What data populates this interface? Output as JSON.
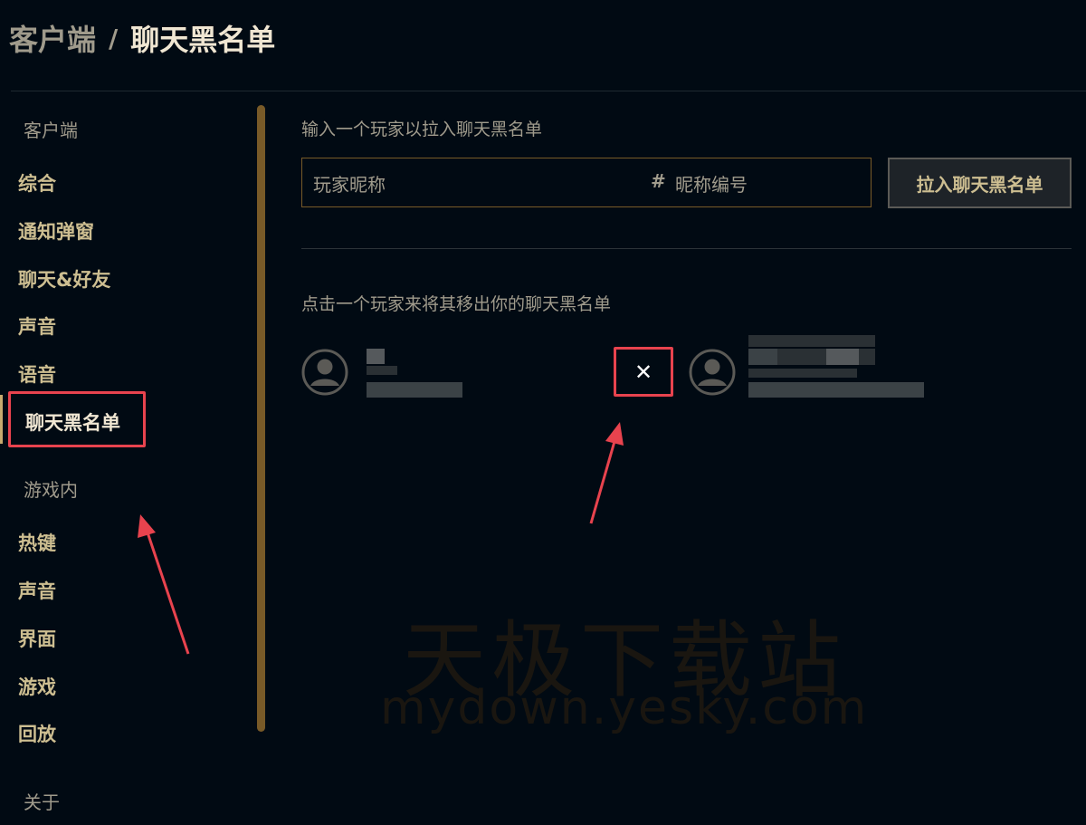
{
  "breadcrumb": {
    "parent": "客户端",
    "separator": "/",
    "current": "聊天黑名单"
  },
  "sidebar": {
    "section_client": "客户端",
    "client_items": [
      {
        "label": "综合"
      },
      {
        "label": "通知弹窗"
      },
      {
        "label": "聊天&好友"
      },
      {
        "label": "声音"
      },
      {
        "label": "语音"
      },
      {
        "label": "聊天黑名单",
        "active": true
      }
    ],
    "section_ingame": "游戏内",
    "ingame_items": [
      {
        "label": "热键"
      },
      {
        "label": "声音"
      },
      {
        "label": "界面"
      },
      {
        "label": "游戏"
      },
      {
        "label": "回放"
      }
    ],
    "section_about": "关于"
  },
  "main": {
    "add_prompt": "输入一个玩家以拉入聊天黑名单",
    "name_placeholder": "玩家昵称",
    "tag_placeholder": "昵称编号",
    "hash_icon": "#",
    "add_button": "拉入聊天黑名单",
    "remove_prompt": "点击一个玩家来将其移出你的聊天黑名单",
    "remove_icon": "✕"
  },
  "watermark": {
    "cn": "天极下载站",
    "en": "mydown.yesky.com"
  },
  "colors": {
    "background": "#010a13",
    "gold": "#cdbe91",
    "gold_dark": "#785a28",
    "text_muted": "#a09b8c",
    "highlight_red": "#e8434e"
  }
}
